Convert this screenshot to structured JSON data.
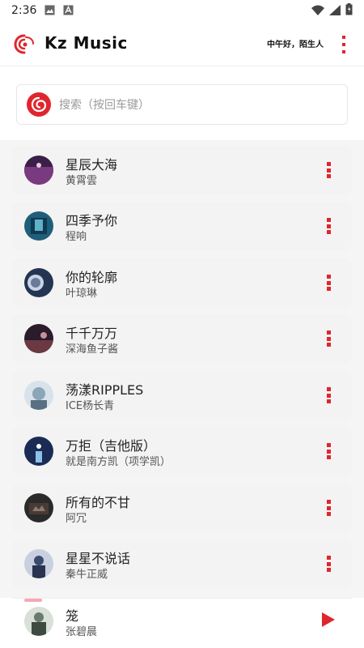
{
  "status_bar": {
    "time": "2:36",
    "icons": [
      "image-icon",
      "a-notification-icon",
      "wifi-icon",
      "signal-icon",
      "battery-icon"
    ]
  },
  "header": {
    "title": "Kz Music",
    "greeting": "中午好，陌生人"
  },
  "search": {
    "placeholder": "搜索（按回车键）"
  },
  "songs": [
    {
      "title": "星辰大海",
      "artist": "黄霄雲",
      "cover_color": "#7a3a7f"
    },
    {
      "title": "四季予你",
      "artist": "程响",
      "cover_color": "#1f5e7a"
    },
    {
      "title": "你的轮廓",
      "artist": "叶琼琳",
      "cover_color": "#243552"
    },
    {
      "title": "千千万万",
      "artist": "深海鱼子酱",
      "cover_color": "#6b3942"
    },
    {
      "title": "荡漾RIPPLES",
      "artist": "ICE杨长青",
      "cover_color": "#8aa6b8"
    },
    {
      "title": "万拒（吉他版）",
      "artist": "就是南方凯（项学凯）",
      "cover_color": "#1a2c55"
    },
    {
      "title": "所有的不甘",
      "artist": "阿冗",
      "cover_color": "#2a2a2a"
    },
    {
      "title": "星星不说话",
      "artist": "秦牛正威",
      "cover_color": "#3a4a70"
    }
  ],
  "now_playing": {
    "title": "笼",
    "artist": "张碧晨",
    "cover_color": "#6a7b6e"
  },
  "colors": {
    "accent": "#e0262d",
    "list_bg": "#f5f5f5",
    "card_bg": "#f3f3f3"
  }
}
